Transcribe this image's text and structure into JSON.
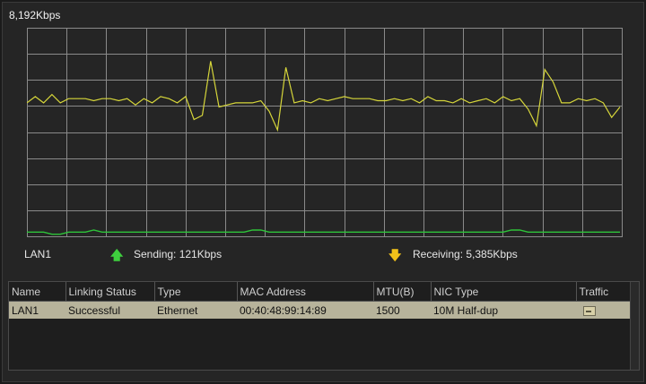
{
  "chart": {
    "scale_label": "8,192Kbps",
    "receiving_values": [
      64,
      67,
      64,
      68,
      64,
      66,
      66,
      66,
      65,
      66,
      66,
      65,
      66,
      63,
      66,
      64,
      67,
      66,
      64,
      67,
      56,
      58,
      84,
      62,
      63,
      64,
      64,
      64,
      65,
      60,
      51,
      81,
      64,
      65,
      64,
      66,
      65,
      66,
      67,
      66,
      66,
      66,
      65,
      65,
      66,
      65,
      66,
      64,
      67,
      65,
      65,
      64,
      66,
      64,
      65,
      66,
      64,
      67,
      65,
      66,
      61,
      53,
      80,
      74,
      64,
      64,
      66,
      65,
      66,
      64,
      57,
      62
    ],
    "sending_values": [
      2,
      2,
      2,
      1,
      1,
      2,
      2,
      2,
      3,
      2,
      2,
      2,
      2,
      2,
      2,
      2,
      2,
      2,
      2,
      2,
      2,
      2,
      2,
      2,
      2,
      2,
      2,
      3,
      3,
      2,
      2,
      2,
      2,
      2,
      2,
      2,
      2,
      2,
      2,
      2,
      2,
      2,
      2,
      2,
      2,
      2,
      2,
      2,
      2,
      2,
      2,
      2,
      2,
      2,
      2,
      2,
      2,
      2,
      3,
      3,
      2,
      2,
      2,
      2,
      2,
      2,
      2,
      2,
      2,
      2,
      2,
      2
    ],
    "colors": {
      "receiving": "#d6d63a",
      "sending": "#2ec43a",
      "grid": "#8a8a8a",
      "baseline": "#c8c83a"
    }
  },
  "legend": {
    "interface": "LAN1",
    "sending_label": "Sending: 121Kbps",
    "receiving_label": "Receiving: 5,385Kbps",
    "sending_icon": "up-arrow-icon",
    "receiving_icon": "down-arrow-icon",
    "sending_color": "#3ecf3e",
    "receiving_color": "#f2c21a"
  },
  "table": {
    "headers": [
      "Name",
      "Linking Status",
      "Type",
      "MAC Address",
      "MTU(B)",
      "NIC Type",
      "Traffic"
    ],
    "rows": [
      {
        "name": "LAN1",
        "status": "Successful",
        "type": "Ethernet",
        "mac": "00:40:48:99:14:89",
        "mtu": "1500",
        "nic": "10M Half-dup",
        "traffic_icon": "traffic-graph-icon"
      }
    ]
  }
}
